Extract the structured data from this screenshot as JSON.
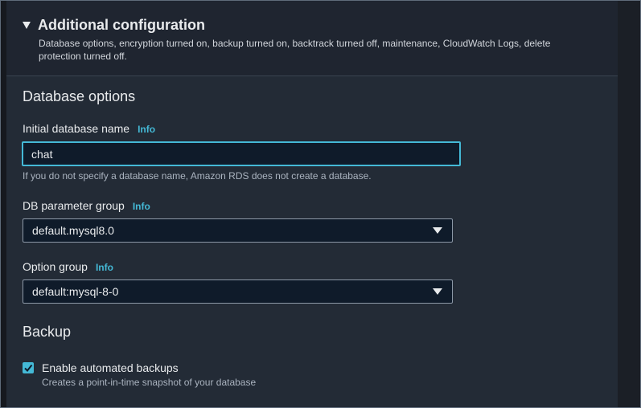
{
  "header": {
    "title": "Additional configuration",
    "description": "Database options, encryption turned on, backup turned on, backtrack turned off, maintenance, CloudWatch Logs, delete protection turned off."
  },
  "database_options": {
    "section_title": "Database options",
    "initial_db_name": {
      "label": "Initial database name",
      "info": "Info",
      "value": "chat",
      "hint": "If you do not specify a database name, Amazon RDS does not create a database."
    },
    "db_parameter_group": {
      "label": "DB parameter group",
      "info": "Info",
      "selected": "default.mysql8.0"
    },
    "option_group": {
      "label": "Option group",
      "info": "Info",
      "selected": "default:mysql-8-0"
    }
  },
  "backup": {
    "section_title": "Backup",
    "automated_backups": {
      "label": "Enable automated backups",
      "description": "Creates a point-in-time snapshot of your database",
      "checked": true
    }
  },
  "colors": {
    "accent": "#44b9d6",
    "panel_bg": "#232b36",
    "input_bg": "#0f1b2a"
  }
}
